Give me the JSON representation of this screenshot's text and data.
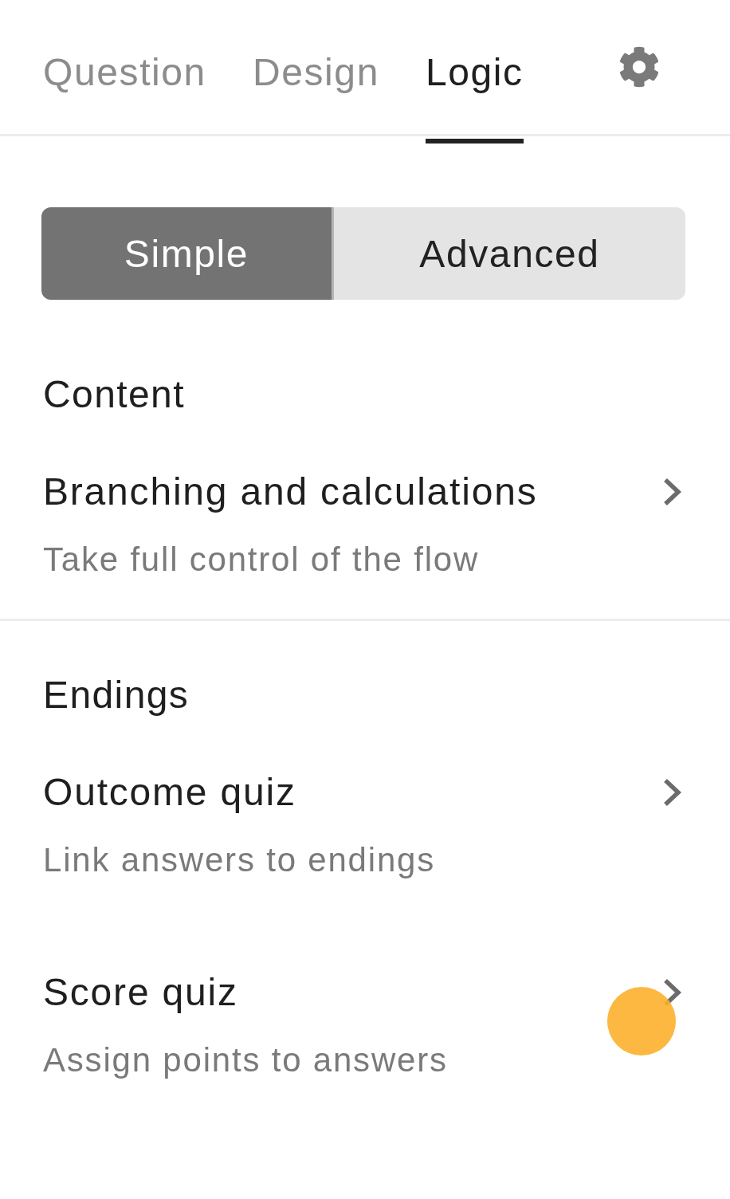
{
  "tabs": [
    {
      "label": "Question",
      "selected": false
    },
    {
      "label": "Design",
      "selected": false
    },
    {
      "label": "Logic",
      "selected": true
    }
  ],
  "mode_switch": [
    {
      "label": "Simple",
      "selected": true
    },
    {
      "label": "Advanced",
      "selected": false
    }
  ],
  "sections": [
    {
      "title": "Content",
      "items": [
        {
          "title": "Branching and calculations",
          "description": "Take full control of the flow"
        }
      ]
    },
    {
      "title": "Endings",
      "items": [
        {
          "title": "Outcome quiz",
          "description": "Link answers to endings"
        },
        {
          "title": "Score quiz",
          "description": "Assign points to answers"
        }
      ]
    }
  ]
}
